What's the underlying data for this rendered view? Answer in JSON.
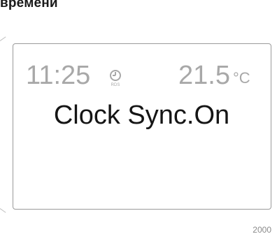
{
  "heading_fragment": "времени",
  "display": {
    "time": "11:25",
    "rds_icon": "clock-rds-icon",
    "rds_label": "RDS",
    "temperature": "21.5",
    "temperature_unit": "°C",
    "message": "Clock Sync.On"
  },
  "image_code": "2000",
  "colors": {
    "status_text": "#a8a8a8",
    "message_text": "#151515",
    "frame": "#9a9a9a"
  }
}
